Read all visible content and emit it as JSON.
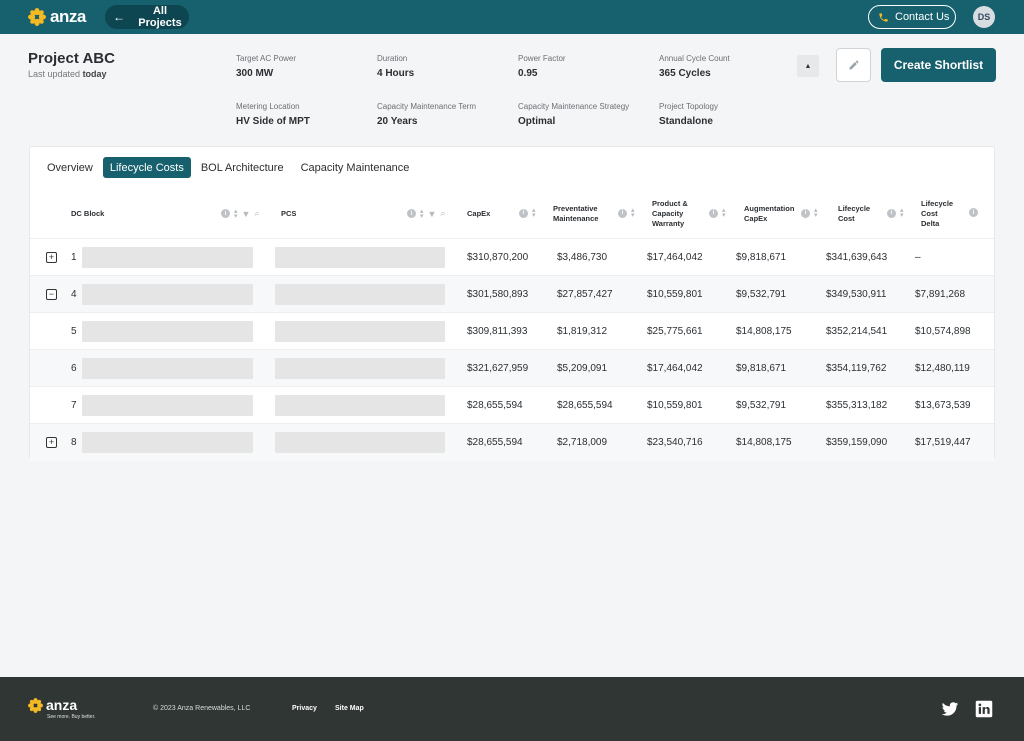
{
  "topbar": {
    "brand": "anza",
    "back_label": "All Projects",
    "contact_label": "Contact Us",
    "avatar_initials": "DS"
  },
  "project": {
    "title": "Project ABC",
    "updated_prefix": "Last updated",
    "updated_value": "today",
    "meta": [
      {
        "label": "Target AC Power",
        "value": "300 MW"
      },
      {
        "label": "Duration",
        "value": "4 Hours"
      },
      {
        "label": "Power Factor",
        "value": "0.95"
      },
      {
        "label": "Annual Cycle Count",
        "value": "365 Cycles"
      },
      {
        "label": "Metering Location",
        "value": "HV Side of MPT"
      },
      {
        "label": "Capacity Maintenance Term",
        "value": "20 Years"
      },
      {
        "label": "Capacity Maintenance Strategy",
        "value": "Optimal"
      },
      {
        "label": "Project Topology",
        "value": "Standalone"
      }
    ],
    "shortlist_label": "Create Shortlist"
  },
  "tabs": [
    {
      "label": "Overview",
      "active": false
    },
    {
      "label": "Lifecycle Costs",
      "active": true
    },
    {
      "label": "BOL Architecture",
      "active": false
    },
    {
      "label": "Capacity Maintenance",
      "active": false
    }
  ],
  "table": {
    "headers": {
      "dc_block": "DC Block",
      "pcs": "PCS",
      "capex": "CapEx",
      "prev_maint": [
        "Preventative",
        "Maintenance"
      ],
      "warranty": [
        "Product &",
        "Capacity",
        "Warranty"
      ],
      "aug_capex": [
        "Augmentation",
        "CapEx"
      ],
      "lifecycle": [
        "Lifecycle",
        "Cost"
      ],
      "delta": [
        "Lifecycle",
        "Cost",
        "Delta"
      ]
    },
    "rows": [
      {
        "expander": "+",
        "num": "1",
        "capex": "$310,870,200",
        "prev": "$3,486,730",
        "warranty": "$17,464,042",
        "aug": "$9,818,671",
        "lifecycle": "$341,639,643",
        "delta": "–"
      },
      {
        "expander": "−",
        "num": "4",
        "capex": "$301,580,893",
        "prev": "$27,857,427",
        "warranty": "$10,559,801",
        "aug": "$9,532,791",
        "lifecycle": "$349,530,911",
        "delta": "$7,891,268"
      },
      {
        "expander": "",
        "num": "5",
        "capex": "$309,811,393",
        "prev": "$1,819,312",
        "warranty": "$25,775,661",
        "aug": "$14,808,175",
        "lifecycle": "$352,214,541",
        "delta": "$10,574,898"
      },
      {
        "expander": "",
        "num": "6",
        "capex": "$321,627,959",
        "prev": "$5,209,091",
        "warranty": "$17,464,042",
        "aug": "$9,818,671",
        "lifecycle": "$354,119,762",
        "delta": "$12,480,119"
      },
      {
        "expander": "",
        "num": "7",
        "capex": "$28,655,594",
        "prev": "$28,655,594",
        "warranty": "$10,559,801",
        "aug": "$9,532,791",
        "lifecycle": "$355,313,182",
        "delta": "$13,673,539"
      },
      {
        "expander": "+",
        "num": "8",
        "capex": "$28,655,594",
        "prev": "$2,718,009",
        "warranty": "$23,540,716",
        "aug": "$14,808,175",
        "lifecycle": "$359,159,090",
        "delta": "$17,519,447"
      }
    ]
  },
  "footer": {
    "brand": "anza",
    "tagline": "See more. Buy better.",
    "copyright": "© 2023 Anza Renewables, LLC",
    "privacy": "Privacy",
    "sitemap": "Site Map",
    "icons": [
      "twitter-icon",
      "linkedin-icon"
    ]
  },
  "colors": {
    "primary": "#17606e",
    "primary_dark": "#0d4651",
    "logo_yellow": "#f5b921",
    "footer_bg": "#303634"
  }
}
